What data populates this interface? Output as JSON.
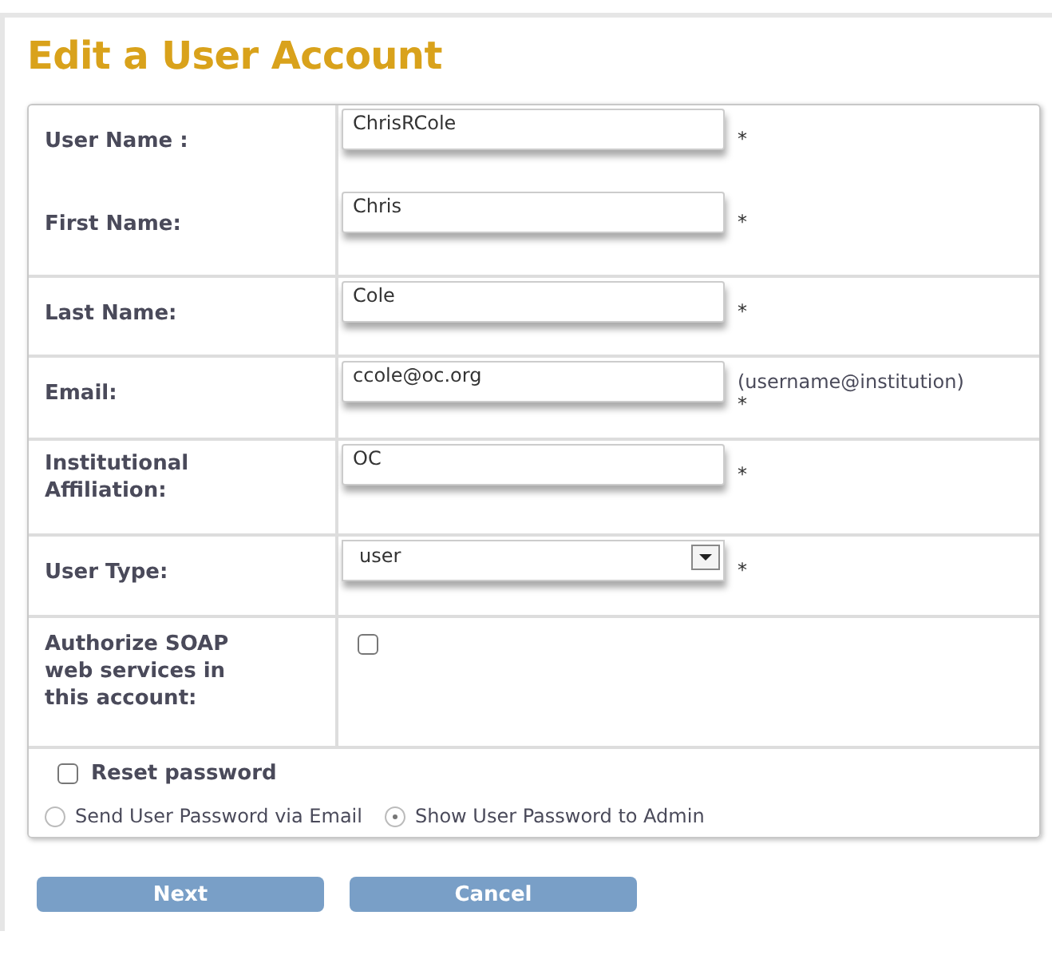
{
  "title": "Edit a User Account",
  "fields": [
    {
      "label": "User Name :",
      "kind": "text",
      "value": "ChrisRCole",
      "required": "*",
      "divider": false
    },
    {
      "label": "First Name:",
      "kind": "text",
      "value": "Chris",
      "required": "*",
      "divider": false
    },
    {
      "label": "Last Name:",
      "kind": "text",
      "value": "Cole",
      "required": "*",
      "divider": true
    },
    {
      "label": "Email:",
      "kind": "text",
      "value": "ccole@oc.org",
      "hint": "(username@institution)",
      "required": "*",
      "divider": true
    },
    {
      "label": "Institutional Affiliation:",
      "kind": "text",
      "value": "OC",
      "required": "*",
      "divider": true
    },
    {
      "label": "User Type:",
      "kind": "select",
      "value": "user",
      "required": "*",
      "divider": true
    },
    {
      "label": "Authorize SOAP web services in this account:",
      "kind": "checkbox",
      "checked": false,
      "divider": true
    }
  ],
  "reset_password": {
    "label": "Reset password",
    "checked": false
  },
  "password_options": [
    {
      "label": "Send User Password via Email",
      "selected": false
    },
    {
      "label": "Show User Password to Admin",
      "selected": true
    }
  ],
  "buttons": [
    "Next",
    "Cancel"
  ]
}
